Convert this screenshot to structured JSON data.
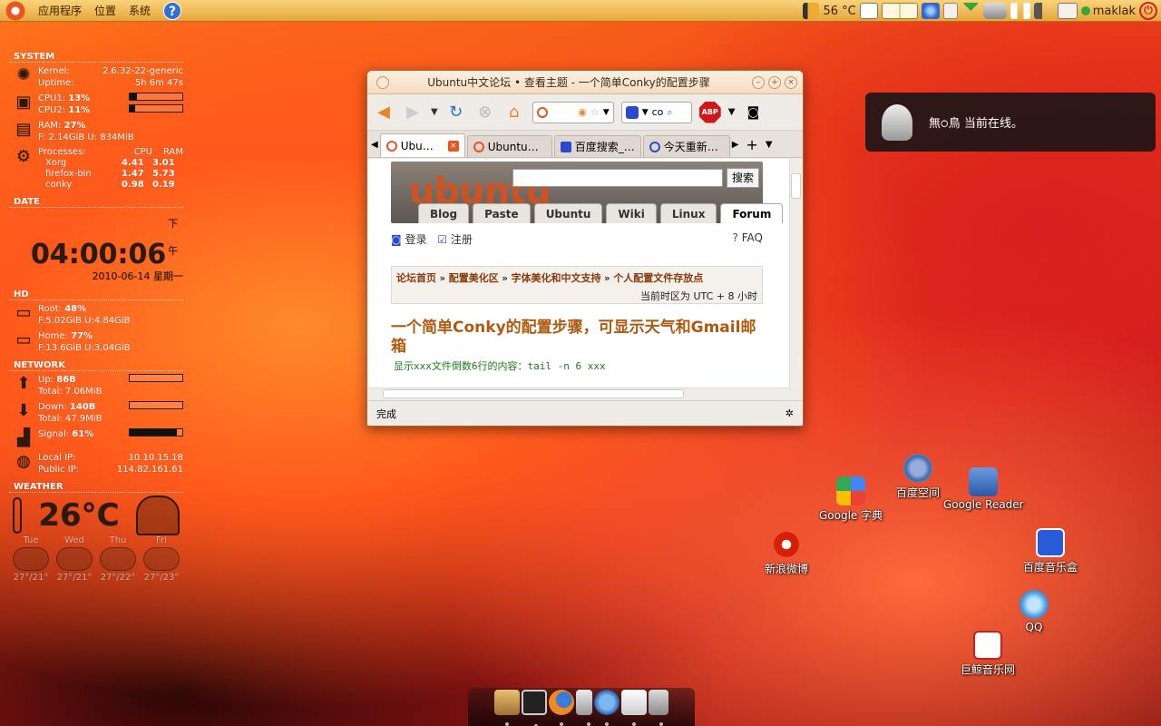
{
  "top_panel": {
    "menus": [
      "应用程序",
      "位置",
      "系统"
    ],
    "temperature": "56 °C",
    "username": "maklak"
  },
  "conky": {
    "system": {
      "header": "SYSTEM",
      "kernel_label": "Kernel:",
      "kernel": "2.6.32-22-generic",
      "uptime_label": "Uptime:",
      "uptime": "5h 6m 47s",
      "cpu1_label": "CPU1:",
      "cpu1": "13%",
      "cpu1_fraction": 0.13,
      "cpu2_label": "CPU2:",
      "cpu2": "11%",
      "cpu2_fraction": 0.11,
      "ram_label": "RAM:",
      "ram": "27%",
      "ram_detail": "F: 2.14GiB U: 834MiB",
      "processes_label": "Processes:",
      "proc_cols": [
        "CPU",
        "RAM"
      ],
      "processes": [
        {
          "name": "Xorg",
          "cpu": "4.41",
          "ram": "3.01"
        },
        {
          "name": "firefox-bin",
          "cpu": "1.47",
          "ram": "5.73"
        },
        {
          "name": "conky",
          "cpu": "0.98",
          "ram": "0.19"
        }
      ]
    },
    "date": {
      "header": "DATE",
      "time": "04:00:06",
      "ampm": "下午",
      "date": "2010-06-14 星期一"
    },
    "hd": {
      "header": "HD",
      "root_label": "Root:",
      "root": "48%",
      "root_detail": "F:5.02GiB U:4.84GiB",
      "home_label": "Home:",
      "home": "77%",
      "home_detail": "F:13.6GiB U:3.04GiB"
    },
    "network": {
      "header": "NETWORK",
      "up_label": "Up:",
      "up": "86B",
      "up_total": "Total: 7.06MiB",
      "down_label": "Down:",
      "down": "140B",
      "down_total": "Total: 47.9MiB",
      "signal_label": "Signal:",
      "signal": "61%",
      "signal_fraction": 0.9,
      "local_ip_label": "Local IP:",
      "local_ip": "10.10.15.18",
      "public_ip_label": "Public IP:",
      "public_ip": "114.82.161.61"
    },
    "weather": {
      "header": "WEATHER",
      "temp": "26°C",
      "forecast": [
        {
          "day": "Tue",
          "range": "27°/21°"
        },
        {
          "day": "Wed",
          "range": "27°/21°"
        },
        {
          "day": "Thu",
          "range": "27°/22°"
        },
        {
          "day": "Fri",
          "range": "27°/23°"
        }
      ]
    }
  },
  "firefox": {
    "title": "Ubuntu中文论坛 • 查看主题 - 一个简单Conky的配置步骤",
    "search_engine_text": "co",
    "abp_label": "ABP",
    "tabs": [
      {
        "label": "Ubu…",
        "active": true
      },
      {
        "label": "Ubuntu…",
        "active": false
      },
      {
        "label": "百度搜索_…",
        "active": false
      },
      {
        "label": "今天重新…",
        "active": false
      }
    ],
    "page": {
      "search_button": "搜索",
      "nav_tabs": [
        "Blog",
        "Paste",
        "Ubuntu",
        "Wiki",
        "Linux",
        "Forum"
      ],
      "login": "登录",
      "register": "注册",
      "faq": "FAQ",
      "breadcrumb": [
        "论坛首页",
        "配置美化区",
        "字体美化和中文支持",
        "个人配置文件存放点"
      ],
      "breadcrumb_sep": "»",
      "timezone": "当前时区为 UTC + 8 小时",
      "topic_title": "一个简单Conky的配置步骤，可显示天气和Gmail邮箱",
      "code_line": "显示xxx文件倒数6行的内容：tail -n 6 xxx"
    },
    "status": "完成"
  },
  "notification": {
    "text": "無੦鳥 当前在线。"
  },
  "desktop_icons": [
    {
      "label": "百度空间"
    },
    {
      "label": "Google 字典"
    },
    {
      "label": "Google Reader"
    },
    {
      "label": "新浪微博"
    },
    {
      "label": "百度音乐盒"
    },
    {
      "label": "QQ"
    },
    {
      "label": "巨鲸音乐网"
    }
  ],
  "colors": {
    "panel": "#f0b552",
    "ubuntu_orange": "#e95420",
    "topic_title": "#b05a10"
  }
}
